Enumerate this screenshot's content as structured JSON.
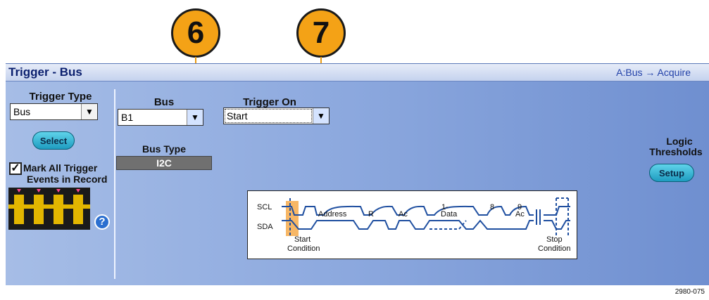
{
  "callouts": [
    {
      "number": "6"
    },
    {
      "number": "7"
    }
  ],
  "window": {
    "title": "Trigger - Bus",
    "trigger_chain": "A:Bus → Acquire"
  },
  "trigger_type": {
    "label": "Trigger Type",
    "value": "Bus",
    "select_button": "Select"
  },
  "bus": {
    "label": "Bus",
    "value": "B1"
  },
  "trigger_on": {
    "label": "Trigger On",
    "value": "Start"
  },
  "bus_type": {
    "label": "Bus Type",
    "value": "I2C"
  },
  "mark_all": {
    "checked": true,
    "label_line1": "Mark All Trigger",
    "label_line2": "Events in Record"
  },
  "help_icon": "?",
  "logic_thresholds": {
    "label_line1": "Logic",
    "label_line2": "Thresholds",
    "setup_button": "Setup"
  },
  "i2c_diagram": {
    "scl_label": "SCL",
    "sda_label": "SDA",
    "address_label": "Address",
    "r_label": "R",
    "ac_label_1": "Ac",
    "data_label": "Data",
    "ac_label_2": "Ac",
    "bit_1_label": "1-",
    "bit_8_label": "8",
    "bit_9_label": "9",
    "start_line1": "Start",
    "start_line2": "Condition",
    "stop_line1": "Stop",
    "stop_line2": "Condition"
  },
  "figure_id": "2980-075",
  "colors": {
    "callout": "#f4a216",
    "panel_light": "#a6bde6",
    "panel_dark": "#6f8fd0",
    "title_text": "#0a1f6e",
    "waveform": "#1f4fa0",
    "highlight": "#f7b766"
  }
}
